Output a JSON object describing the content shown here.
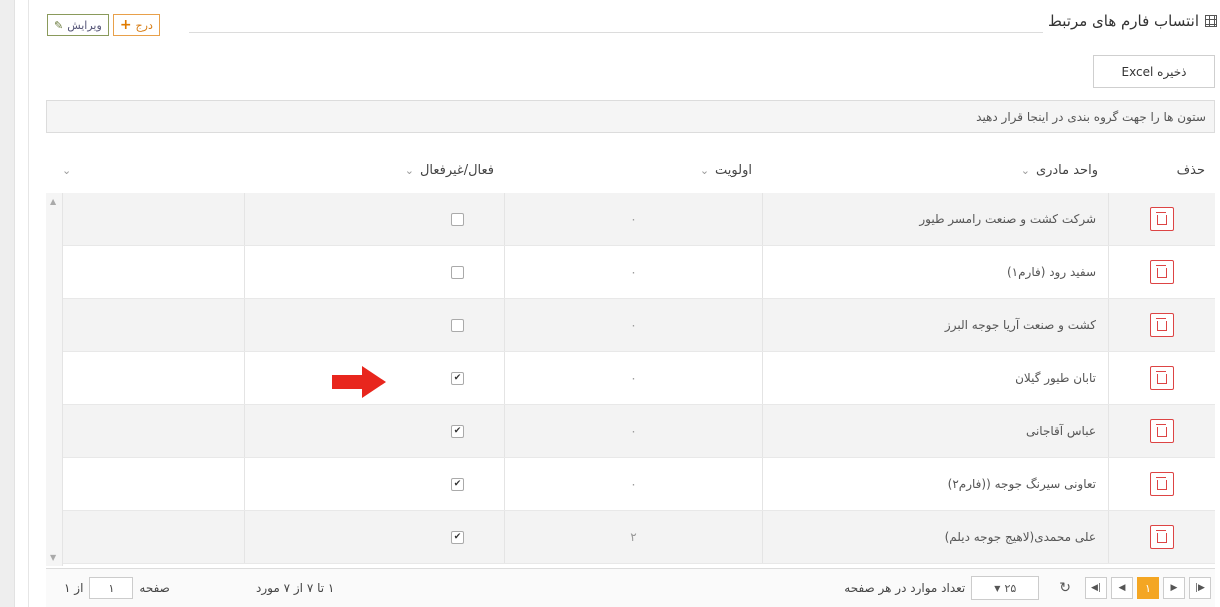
{
  "title": "انتساب فارم های مرتبط",
  "toolbar": {
    "insert_label": "درج",
    "edit_label": "ویرایش"
  },
  "excel_label": "ذخیره Excel",
  "group_hint": "ستون ها را جهت گروه بندی در اینجا قرار دهید",
  "columns": {
    "delete": "حذف",
    "unit": "واحد مادری",
    "priority": "اولویت",
    "active": "فعال/غیرفعال"
  },
  "rows": [
    {
      "unit": "شرکت کشت و صنعت رامسر طیور",
      "priority": "۰",
      "active": false
    },
    {
      "unit": "سفید رود (فارم۱)",
      "priority": "۰",
      "active": false
    },
    {
      "unit": "کشت و صنعت آریا جوجه البرز",
      "priority": "۰",
      "active": false
    },
    {
      "unit": "تابان طیور گیلان",
      "priority": "۰",
      "active": true
    },
    {
      "unit": "عباس آقاجانی",
      "priority": "۰",
      "active": true
    },
    {
      "unit": "تعاونی سیرنگ جوجه ((فارم۲)",
      "priority": "۰",
      "active": true
    },
    {
      "unit": "علی محمدی(لاهیج جوجه دیلم)",
      "priority": "۲",
      "active": true
    }
  ],
  "pager": {
    "current_page": "۱",
    "page_size": "۲۵",
    "page_size_label": "تعداد موارد در هر صفحه",
    "info": "۱ تا ۷ از ۷ مورد",
    "page_label": "صفحه",
    "page_value": "۱",
    "of_label": "از ۱"
  },
  "colors": {
    "accent": "#f4a623",
    "delete": "#dd4444",
    "arrow": "#e8261d"
  }
}
